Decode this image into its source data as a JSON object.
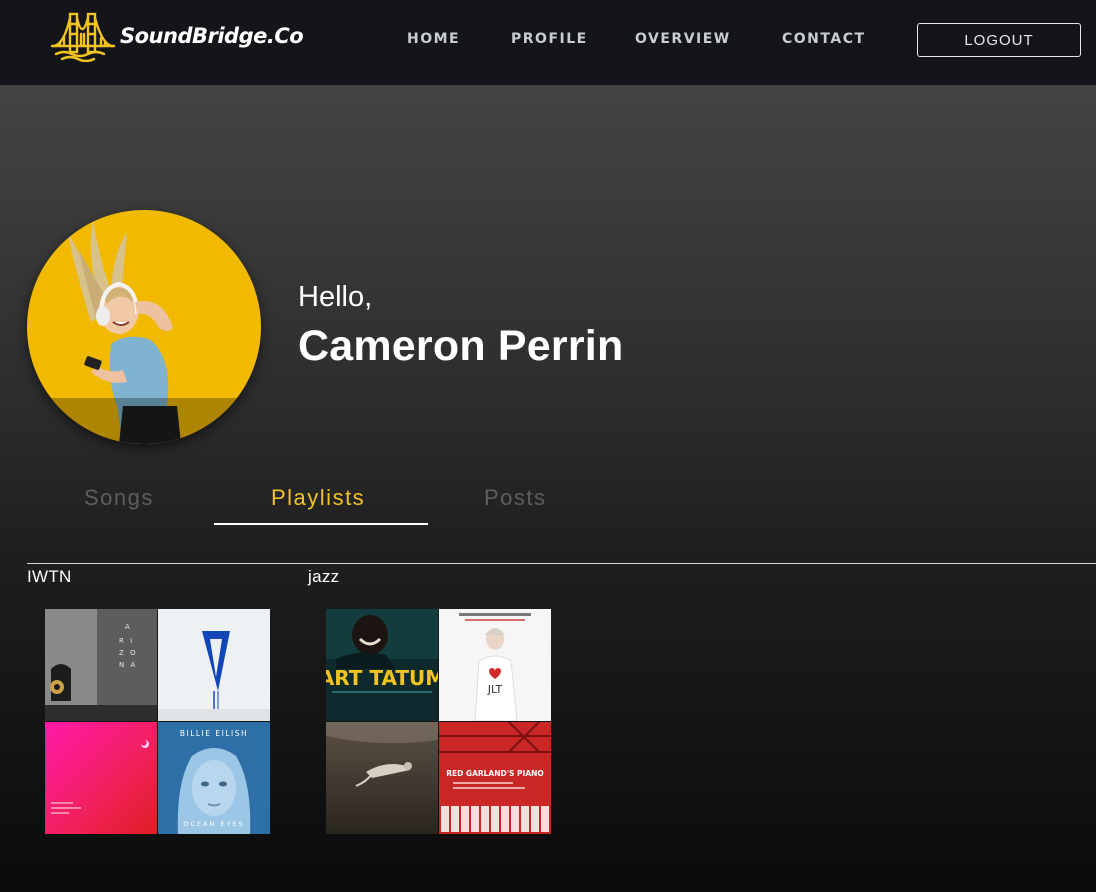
{
  "header": {
    "brand": "SoundBridge.Co",
    "nav": [
      {
        "label": "HOME"
      },
      {
        "label": "PROFILE"
      },
      {
        "label": "OVERVIEW"
      },
      {
        "label": "CONTACT"
      }
    ],
    "logout_label": "LOGOUT",
    "accent_color": "#f2c420"
  },
  "profile": {
    "greeting": "Hello,",
    "name": "Cameron Perrin"
  },
  "tabs": [
    {
      "label": "Songs",
      "active": false
    },
    {
      "label": "Playlists",
      "active": true
    },
    {
      "label": "Posts",
      "active": false
    }
  ],
  "playlists": [
    {
      "title": "IWTN",
      "covers": [
        {
          "lines": [
            "A",
            "R I",
            "Z O",
            "N A"
          ]
        },
        {
          "lines": []
        },
        {
          "lines": []
        },
        {
          "lines": [
            "BILLIE EILISH",
            "OCEAN EYES"
          ]
        }
      ]
    },
    {
      "title": "jazz",
      "covers": [
        {
          "lines": [
            "ART TATUM"
          ]
        },
        {
          "lines": [
            "JLT"
          ]
        },
        {
          "lines": []
        },
        {
          "lines": [
            "RED GARLAND'S PIANO"
          ]
        }
      ]
    }
  ]
}
